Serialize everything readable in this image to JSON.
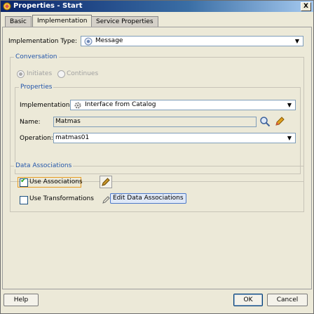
{
  "window": {
    "title": "Properties - Start",
    "close_label": "X"
  },
  "tabs": [
    {
      "label": "Basic",
      "active": false
    },
    {
      "label": "Implementation",
      "active": true
    },
    {
      "label": "Service Properties",
      "active": false
    }
  ],
  "implementation_type": {
    "label": "Implementation Type:",
    "value": "Message"
  },
  "conversation": {
    "title": "Conversation",
    "options": [
      "Initiates",
      "Continues"
    ]
  },
  "properties": {
    "title": "Properties",
    "implementation": {
      "label": "Implementation:",
      "value": "Interface from Catalog"
    },
    "name": {
      "label": "Name:",
      "value": "Matmas"
    },
    "operation": {
      "label": "Operation:",
      "value": "matmas01"
    }
  },
  "data_associations": {
    "title": "Data Associations",
    "use_associations": {
      "label": "Use Associations",
      "checked": true
    },
    "use_transformations": {
      "label": "Use Transformations",
      "checked": false
    },
    "edit_label": "Edit Data Associations"
  },
  "footer": {
    "help": "Help",
    "ok": "OK",
    "cancel": "Cancel"
  },
  "colors": {
    "title_bar": "#0a246a",
    "group_title": "#2255aa",
    "window_bg": "#ece9d8"
  }
}
